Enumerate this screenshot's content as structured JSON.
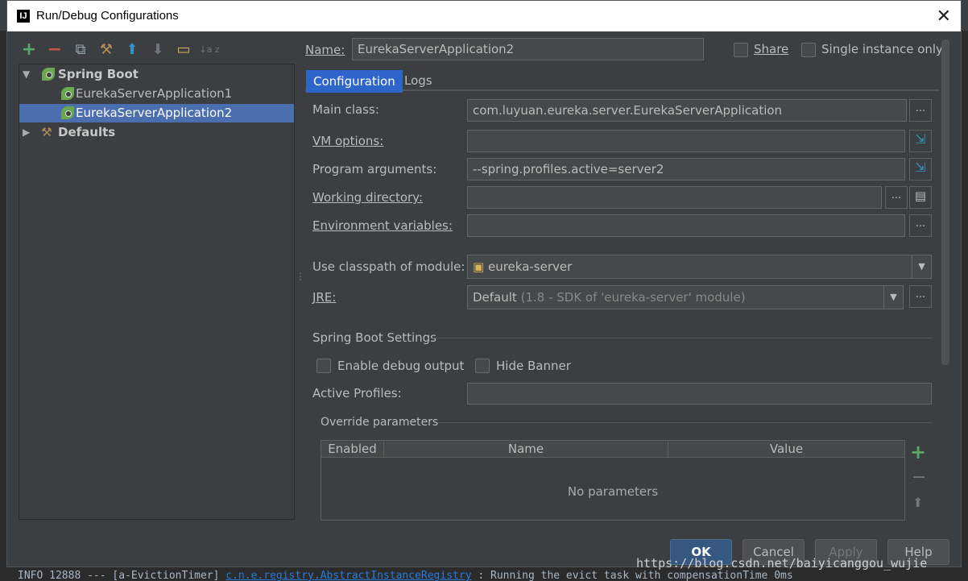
{
  "window": {
    "title": "Run/Debug Configurations",
    "close_glyph": "✕"
  },
  "toolbar": {
    "add": "+",
    "remove": "−",
    "copy": "⧉",
    "edit_defaults": "⚒",
    "move_up": "⬆",
    "move_down": "⬇",
    "folder": "▭",
    "sort": "↓a z"
  },
  "tree": {
    "spring_boot": "Spring Boot",
    "items": [
      "EurekaServerApplication1",
      "EurekaServerApplication2"
    ],
    "defaults": "Defaults"
  },
  "name": {
    "label": "Name:",
    "value": "EurekaServerApplication2"
  },
  "share": {
    "label": "Share"
  },
  "single_instance": {
    "label": "Single instance only"
  },
  "tabs": [
    "Configuration",
    "Logs"
  ],
  "form": {
    "main_class": {
      "label": "Main class:",
      "value": "com.luyuan.eureka.server.EurekaServerApplication"
    },
    "vm_options": {
      "label": "VM options:",
      "value": ""
    },
    "program_args": {
      "label": "Program arguments:",
      "value": "--spring.profiles.active=server2"
    },
    "working_dir": {
      "label": "Working directory:",
      "value": ""
    },
    "env_vars": {
      "label": "Environment variables:",
      "value": ""
    },
    "classpath_module": {
      "label": "Use classpath of module:",
      "value": "eureka-server"
    },
    "jre": {
      "label": "JRE:",
      "value": "Default",
      "hint": "(1.8 - SDK of 'eureka-server' module)"
    },
    "ellipsis": "..."
  },
  "spring_boot_settings": {
    "title": "Spring Boot Settings",
    "enable_debug": "Enable debug output",
    "hide_banner": "Hide Banner",
    "active_profiles_label": "Active Profiles:"
  },
  "override": {
    "title": "Override parameters",
    "columns": [
      "Enabled",
      "Name",
      "Value"
    ],
    "empty": "No parameters",
    "add": "+",
    "remove": "−",
    "up": "⬆"
  },
  "buttons": {
    "ok": "OK",
    "cancel": "Cancel",
    "apply": "Apply",
    "help": "Help"
  },
  "background": {
    "log_line_prefix": "INFO 12888 --- [a-EvictionTimer] ",
    "log_line_pkg": "c.n.e.registry.AbstractInstanceRegistry",
    "log_line_suffix": "  : Running the evict task with compensationTime 0ms"
  },
  "watermark": "https://blog.csdn.net/baiyicanggou_wujie",
  "colors": {
    "selection": "#4b6eaf",
    "active_tab": "#2f65ca",
    "ok_button": "#365880",
    "leaf": "#6aa84f"
  }
}
